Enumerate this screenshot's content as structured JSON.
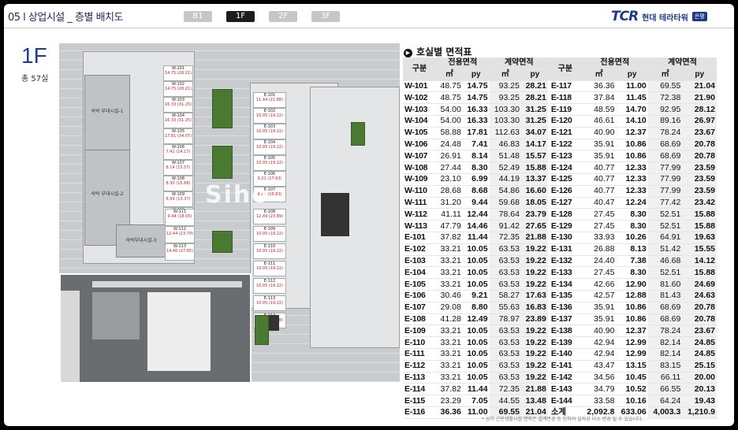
{
  "header": {
    "title": "05 l 상업시설 _ 층별 배치도",
    "tabs": [
      "B1",
      "1F",
      "2F",
      "3F"
    ],
    "active_tab": "1F",
    "logo_mark": "TCR",
    "logo_name": "현대 테라타워",
    "logo_badge": "은평"
  },
  "floor": {
    "label": "1F",
    "count": "총 57실"
  },
  "plan": {
    "watermark": "Siho",
    "west_units": [
      {
        "id": "W-101",
        "val": "14.75 (28.21)"
      },
      {
        "id": "W-102",
        "val": "14.75 (28.21)"
      },
      {
        "id": "W-103",
        "val": "16.33 (31.25)"
      },
      {
        "id": "W-104",
        "val": "16.33 (31.25)"
      },
      {
        "id": "W-105",
        "val": "17.81 (34.07)"
      },
      {
        "id": "W-106",
        "val": "7.41 (14.17)"
      },
      {
        "id": "W-107",
        "val": "8.14 (15.57)"
      },
      {
        "id": "W-108",
        "val": "8.30 (15.88)"
      },
      {
        "id": "W-109",
        "val": "6.99 (13.37)"
      },
      {
        "id": "W-110",
        "val": "8.68 (16.60)"
      },
      {
        "id": "W-111",
        "val": "9.44 (18.05)"
      },
      {
        "id": "W-112",
        "val": "12.44 (23.79)"
      },
      {
        "id": "W-113",
        "val": "14.46 (27.65)"
      }
    ],
    "labels": [
      "숙박 부대시설-1",
      "숙박 부대시설-2",
      "숙박부대시설-3"
    ],
    "mid_units": [
      {
        "id": "E-101",
        "val": "11.44 (21.88)"
      },
      {
        "id": "E-102",
        "val": "10.05 (19.22)"
      },
      {
        "id": "E-103",
        "val": "10.05 (19.22)"
      },
      {
        "id": "E-104",
        "val": "10.05 (19.22)"
      },
      {
        "id": "E-105",
        "val": "10.05 (19.22)"
      },
      {
        "id": "E-106",
        "val": "9.21 (17.63)"
      },
      {
        "id": "E-107",
        "val": "8.80 (16.83)"
      },
      {
        "id": "E-108",
        "val": "12.49 (23.89)"
      },
      {
        "id": "E-109",
        "val": "10.05 (19.22)"
      },
      {
        "id": "E-110",
        "val": "10.05 (19.22)"
      },
      {
        "id": "E-111",
        "val": "10.05 (19.22)"
      },
      {
        "id": "E-112",
        "val": "10.05 (19.22)"
      },
      {
        "id": "E-113",
        "val": "10.05 (19.22)"
      },
      {
        "id": "E-114",
        "val": "11.44 (21.88)"
      }
    ]
  },
  "table": {
    "title": "호실별 면적표",
    "col_unit": "구분",
    "col_exclusive": "전용면적",
    "col_contract": "계약면적",
    "unit_m2": "㎡",
    "unit_py": "py",
    "rows_left": [
      [
        "W-101",
        "48.75",
        "14.75",
        "93.25",
        "28.21"
      ],
      [
        "W-102",
        "48.75",
        "14.75",
        "93.25",
        "28.21"
      ],
      [
        "W-103",
        "54.00",
        "16.33",
        "103.30",
        "31.25"
      ],
      [
        "W-104",
        "54.00",
        "16.33",
        "103.30",
        "31.25"
      ],
      [
        "W-105",
        "58.88",
        "17.81",
        "112.63",
        "34.07"
      ],
      [
        "W-106",
        "24.48",
        "7.41",
        "46.83",
        "14.17"
      ],
      [
        "W-107",
        "26.91",
        "8.14",
        "51.48",
        "15.57"
      ],
      [
        "W-108",
        "27.44",
        "8.30",
        "52.49",
        "15.88"
      ],
      [
        "W-109",
        "23.10",
        "6.99",
        "44.19",
        "13.37"
      ],
      [
        "W-110",
        "28.68",
        "8.68",
        "54.86",
        "16.60"
      ],
      [
        "W-111",
        "31.20",
        "9.44",
        "59.68",
        "18.05"
      ],
      [
        "W-112",
        "41.11",
        "12.44",
        "78.64",
        "23.79"
      ],
      [
        "W-113",
        "47.79",
        "14.46",
        "91.42",
        "27.65"
      ],
      [
        "E-101",
        "37.82",
        "11.44",
        "72.35",
        "21.88"
      ],
      [
        "E-102",
        "33.21",
        "10.05",
        "63.53",
        "19.22"
      ],
      [
        "E-103",
        "33.21",
        "10.05",
        "63.53",
        "19.22"
      ],
      [
        "E-104",
        "33.21",
        "10.05",
        "63.53",
        "19.22"
      ],
      [
        "E-105",
        "33.21",
        "10.05",
        "63.53",
        "19.22"
      ],
      [
        "E-106",
        "30.46",
        "9.21",
        "58.27",
        "17.63"
      ],
      [
        "E-107",
        "29.08",
        "8.80",
        "55.63",
        "16.83"
      ],
      [
        "E-108",
        "41.28",
        "12.49",
        "78.97",
        "23.89"
      ],
      [
        "E-109",
        "33.21",
        "10.05",
        "63.53",
        "19.22"
      ],
      [
        "E-110",
        "33.21",
        "10.05",
        "63.53",
        "19.22"
      ],
      [
        "E-111",
        "33.21",
        "10.05",
        "63.53",
        "19.22"
      ],
      [
        "E-112",
        "33.21",
        "10.05",
        "63.53",
        "19.22"
      ],
      [
        "E-113",
        "33.21",
        "10.05",
        "63.53",
        "19.22"
      ],
      [
        "E-114",
        "37.82",
        "11.44",
        "72.35",
        "21.88"
      ],
      [
        "E-115",
        "23.29",
        "7.05",
        "44.55",
        "13.48"
      ],
      [
        "E-116",
        "36.36",
        "11.00",
        "69.55",
        "21.04"
      ]
    ],
    "rows_right": [
      [
        "E-117",
        "36.36",
        "11.00",
        "69.55",
        "21.04"
      ],
      [
        "E-118",
        "37.84",
        "11.45",
        "72.38",
        "21.90"
      ],
      [
        "E-119",
        "48.59",
        "14.70",
        "92.95",
        "28.12"
      ],
      [
        "E-120",
        "46.61",
        "14.10",
        "89.16",
        "26.97"
      ],
      [
        "E-121",
        "40.90",
        "12.37",
        "78.24",
        "23.67"
      ],
      [
        "E-122",
        "35.91",
        "10.86",
        "68.69",
        "20.78"
      ],
      [
        "E-123",
        "35.91",
        "10.86",
        "68.69",
        "20.78"
      ],
      [
        "E-124",
        "40.77",
        "12.33",
        "77.99",
        "23.59"
      ],
      [
        "E-125",
        "40.77",
        "12.33",
        "77.99",
        "23.59"
      ],
      [
        "E-126",
        "40.77",
        "12.33",
        "77.99",
        "23.59"
      ],
      [
        "E-127",
        "40.47",
        "12.24",
        "77.42",
        "23.42"
      ],
      [
        "E-128",
        "27.45",
        "8.30",
        "52.51",
        "15.88"
      ],
      [
        "E-129",
        "27.45",
        "8.30",
        "52.51",
        "15.88"
      ],
      [
        "E-130",
        "33.93",
        "10.26",
        "64.91",
        "19.63"
      ],
      [
        "E-131",
        "26.88",
        "8.13",
        "51.42",
        "15.55"
      ],
      [
        "E-132",
        "24.40",
        "7.38",
        "46.68",
        "14.12"
      ],
      [
        "E-133",
        "27.45",
        "8.30",
        "52.51",
        "15.88"
      ],
      [
        "E-134",
        "42.66",
        "12.90",
        "81.60",
        "24.69"
      ],
      [
        "E-135",
        "42.57",
        "12.88",
        "81.43",
        "24.63"
      ],
      [
        "E-136",
        "35.91",
        "10.86",
        "68.69",
        "20.78"
      ],
      [
        "E-137",
        "35.91",
        "10.86",
        "68.69",
        "20.78"
      ],
      [
        "E-138",
        "40.90",
        "12.37",
        "78.24",
        "23.67"
      ],
      [
        "E-139",
        "42.94",
        "12.99",
        "82.14",
        "24.85"
      ],
      [
        "E-140",
        "42.94",
        "12.99",
        "82.14",
        "24.85"
      ],
      [
        "E-141",
        "43.47",
        "13.15",
        "83.15",
        "25.15"
      ],
      [
        "E-142",
        "34.56",
        "10.45",
        "66.11",
        "20.00"
      ],
      [
        "E-143",
        "34.79",
        "10.52",
        "66.55",
        "20.13"
      ],
      [
        "E-144",
        "33.58",
        "10.16",
        "64.24",
        "19.43"
      ],
      [
        "소계",
        "2,092.8",
        "633.06",
        "4,003.3",
        "1,210.9"
      ]
    ],
    "note": "* 상기 근린생활시설 면적은 설계변경 등 인하여 일자상 다소 변경 될 수 있습니다."
  }
}
